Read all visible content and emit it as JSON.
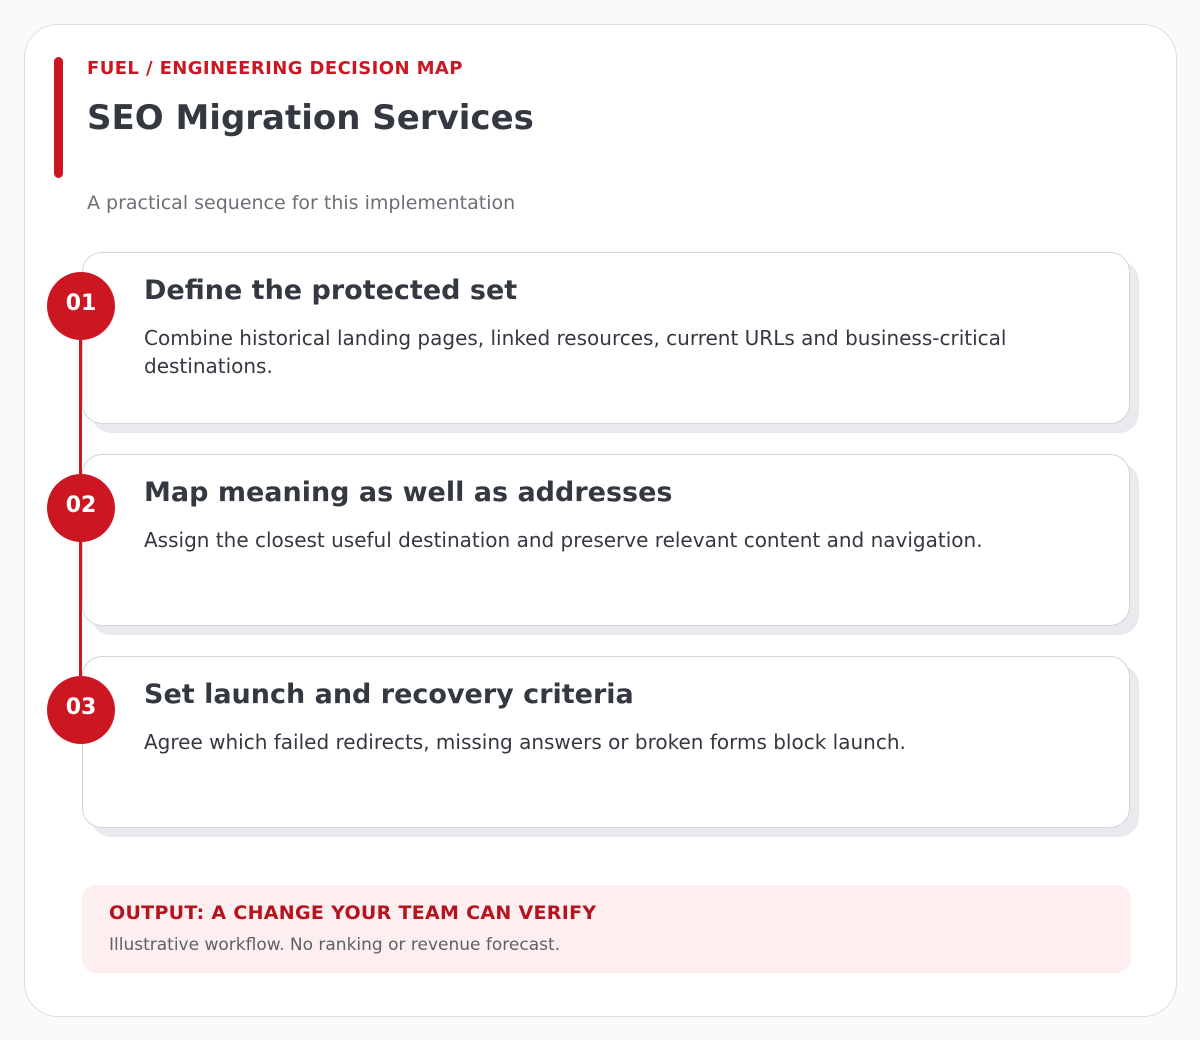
{
  "header": {
    "eyebrow": "FUEL / ENGINEERING DECISION MAP",
    "title": "SEO Migration Services",
    "subtitle": "A practical sequence for this implementation"
  },
  "steps": [
    {
      "number": "01",
      "title": "Define the protected set",
      "description": "Combine historical landing pages, linked resources, current URLs and business-critical destinations."
    },
    {
      "number": "02",
      "title": "Map meaning as well as addresses",
      "description": "Assign the closest useful destination and preserve relevant content and navigation."
    },
    {
      "number": "03",
      "title": "Set launch and recovery criteria",
      "description": "Agree which failed redirects, missing answers or broken forms block launch."
    }
  ],
  "output": {
    "title": "OUTPUT: A CHANGE YOUR TEAM CAN VERIFY",
    "note": "Illustrative workflow. No ranking or revenue forecast."
  },
  "colors": {
    "accent": "#cc1722",
    "text": "#343840",
    "muted": "#6b6f76",
    "output_bg": "#fdeff0"
  }
}
